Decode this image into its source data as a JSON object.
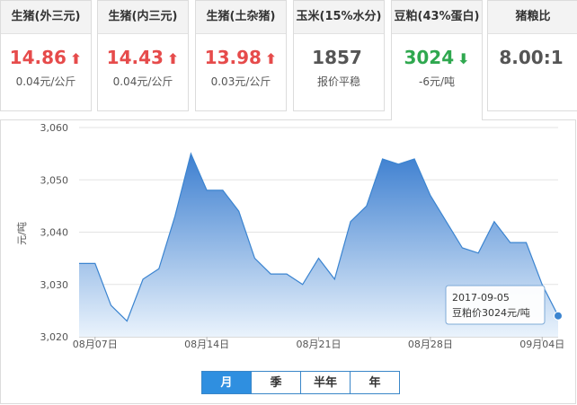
{
  "cards": [
    {
      "title": "生猪(外三元)",
      "price": "14.86",
      "trend": "up",
      "arrow": "⬆",
      "change": "0.04元/公斤"
    },
    {
      "title": "生猪(内三元)",
      "price": "14.43",
      "trend": "up",
      "arrow": "⬆",
      "change": "0.04元/公斤"
    },
    {
      "title": "生猪(土杂猪)",
      "price": "13.98",
      "trend": "up",
      "arrow": "⬆",
      "change": "0.03元/公斤"
    },
    {
      "title": "玉米(15%水分)",
      "price": "1857",
      "trend": "flat",
      "arrow": "",
      "change": "报价平稳"
    },
    {
      "title": "豆粕(43%蛋白)",
      "price": "3024",
      "trend": "down",
      "arrow": "⬇",
      "change": "-6元/吨"
    },
    {
      "title": "猪粮比",
      "price": "8.00:1",
      "trend": "flat",
      "arrow": "",
      "change": ""
    }
  ],
  "active_card": 4,
  "colors": {
    "up": "#e64b4b",
    "down": "#2fa84f",
    "line": "#3b84d0",
    "fill_top": "#3d7fd0",
    "fill_bottom": "#eaf3fc",
    "tab_active": "#2f8fe0"
  },
  "tabs": [
    "月",
    "季",
    "半年",
    "年"
  ],
  "selected_tab": 0,
  "tooltip": {
    "date": "2017-09-05",
    "text": "豆粕价3024元/吨"
  },
  "chart_data": {
    "type": "area",
    "ylabel": "元/吨",
    "ylim": [
      3020,
      3060
    ],
    "yticks": [
      3020,
      3030,
      3040,
      3050,
      3060
    ],
    "ytick_labels": [
      "3,020",
      "3,030",
      "3,040",
      "3,050",
      "3,060"
    ],
    "xtick_labels": [
      {
        "day": 7,
        "label": "08月07日"
      },
      {
        "day": 14,
        "label": "08月14日"
      },
      {
        "day": 21,
        "label": "08月21日"
      },
      {
        "day": 28,
        "label": "08月28日"
      },
      {
        "day": 35,
        "label": "09月04日"
      }
    ],
    "x": [
      "2017-08-06",
      "2017-08-07",
      "2017-08-08",
      "2017-08-09",
      "2017-08-10",
      "2017-08-11",
      "2017-08-12",
      "2017-08-13",
      "2017-08-14",
      "2017-08-15",
      "2017-08-16",
      "2017-08-17",
      "2017-08-18",
      "2017-08-19",
      "2017-08-20",
      "2017-08-21",
      "2017-08-22",
      "2017-08-23",
      "2017-08-24",
      "2017-08-25",
      "2017-08-26",
      "2017-08-27",
      "2017-08-28",
      "2017-08-29",
      "2017-08-30",
      "2017-08-31",
      "2017-09-01",
      "2017-09-02",
      "2017-09-03",
      "2017-09-04",
      "2017-09-05"
    ],
    "series": [
      {
        "values": [
          3034,
          3034,
          3026,
          3023,
          3031,
          3033,
          3043,
          3055,
          3048,
          3048,
          3044,
          3035,
          3032,
          3032,
          3030,
          3035,
          3031,
          3042,
          3045,
          3054,
          3053,
          3054,
          3047,
          3042,
          3037,
          3036,
          3042,
          3038,
          3038,
          3030,
          3024
        ]
      }
    ],
    "grid": true,
    "highlight_index": 30
  }
}
